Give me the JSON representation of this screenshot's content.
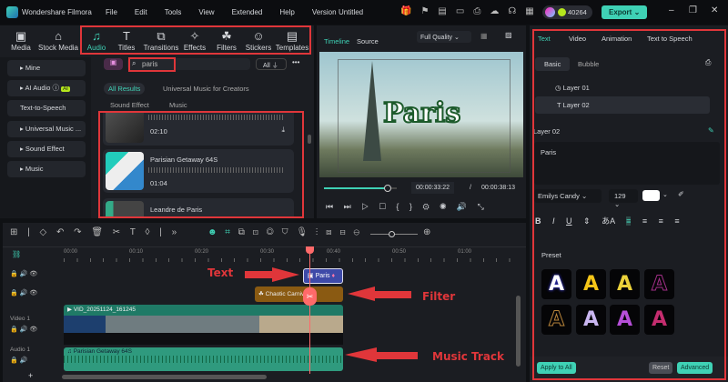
{
  "app": {
    "name": "Wondershare Filmora",
    "project": "Untitled",
    "credits": "40264",
    "export": "Export"
  },
  "menu": [
    "File",
    "Edit",
    "Tools",
    "View",
    "Extended",
    "Help",
    "Version"
  ],
  "toolbar_tabs": [
    {
      "label": "Media",
      "icon": "media-icon"
    },
    {
      "label": "Stock Media",
      "icon": "stock-icon"
    },
    {
      "label": "Audio",
      "icon": "music-note-icon"
    },
    {
      "label": "Titles",
      "icon": "title-icon"
    },
    {
      "label": "Transitions",
      "icon": "transition-icon"
    },
    {
      "label": "Effects",
      "icon": "effects-icon"
    },
    {
      "label": "Filters",
      "icon": "filters-icon"
    },
    {
      "label": "Stickers",
      "icon": "sticker-icon"
    },
    {
      "label": "Templates",
      "icon": "template-icon"
    }
  ],
  "sidebar": {
    "items": [
      "Mine",
      "AI Audio",
      "Text-to-Speech",
      "Universal Music ...",
      "Sound Effect",
      "Music"
    ],
    "ai_badge": "AI"
  },
  "search": {
    "value": "paris",
    "filter": "All"
  },
  "result_tabs": [
    "All Results",
    "Universal Music for Creators"
  ],
  "sub_tabs": [
    "Sound Effect",
    "Music"
  ],
  "results": [
    {
      "title": "",
      "duration": "02:10"
    },
    {
      "title": "Parisian Getaway 64S",
      "duration": "01:04"
    },
    {
      "title": "Leandre de Paris",
      "duration": ""
    }
  ],
  "preview": {
    "tabs": [
      "Timeline",
      "Source"
    ],
    "quality": "Full Quality",
    "overlay_text": "Paris",
    "current_time": "00:00:33:22",
    "separator": "/",
    "total_time": "00:00:38:13",
    "progress": 0.88
  },
  "right_panel": {
    "tabs": [
      "Text",
      "Video",
      "Animation",
      "Text to Speech"
    ],
    "sub_tabs": [
      "Basic",
      "Bubble"
    ],
    "layers": [
      "Layer 01",
      "Layer 02"
    ],
    "layer_title": "Layer 02",
    "text_value": "Paris",
    "font": "Emilys Candy",
    "size": "129",
    "text_color": "#ffffff",
    "format": [
      "B",
      "I",
      "U"
    ],
    "preset_label": "Preset",
    "apply_all": "Apply to All",
    "reset": "Reset",
    "advanced": "Advanced"
  },
  "timeline": {
    "ruler": [
      "00:00",
      "00:10",
      "00:20",
      "00:30",
      "00:40",
      "00:50",
      "01:00"
    ],
    "playhead_seconds": 37,
    "tracks": {
      "video": "Video 1",
      "audio": "Audio 1"
    },
    "clips": {
      "text": "Paris",
      "filter": "Chaotic Carniv...",
      "video": "VID_20251124_161245",
      "audio": "Parisian Getaway 64S"
    }
  },
  "annotations": {
    "text": "Text",
    "filter": "Filter",
    "music": "Music Track"
  },
  "colors": {
    "accent": "#3fd1b5",
    "annotation": "#e0363a",
    "text_clip": "#3e4aa8",
    "filter_clip": "#8a5a12",
    "video_clip": "#1f7a66",
    "audio_clip": "#2f9a7e"
  }
}
